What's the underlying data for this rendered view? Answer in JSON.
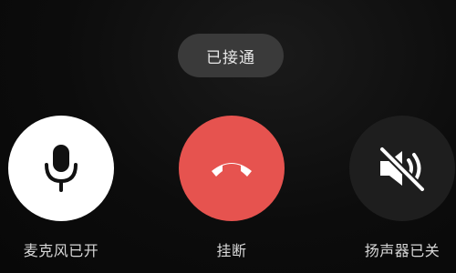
{
  "status": {
    "text": "已接通"
  },
  "controls": {
    "microphone": {
      "label": "麦克风已开",
      "icon": "microphone-icon",
      "bg": "#ffffff"
    },
    "hangup": {
      "label": "挂断",
      "icon": "phone-hangup-icon",
      "bg": "#e6534f"
    },
    "speaker": {
      "label": "扬声器已关",
      "icon": "speaker-muted-icon",
      "bg": "#1e1e1e"
    }
  }
}
